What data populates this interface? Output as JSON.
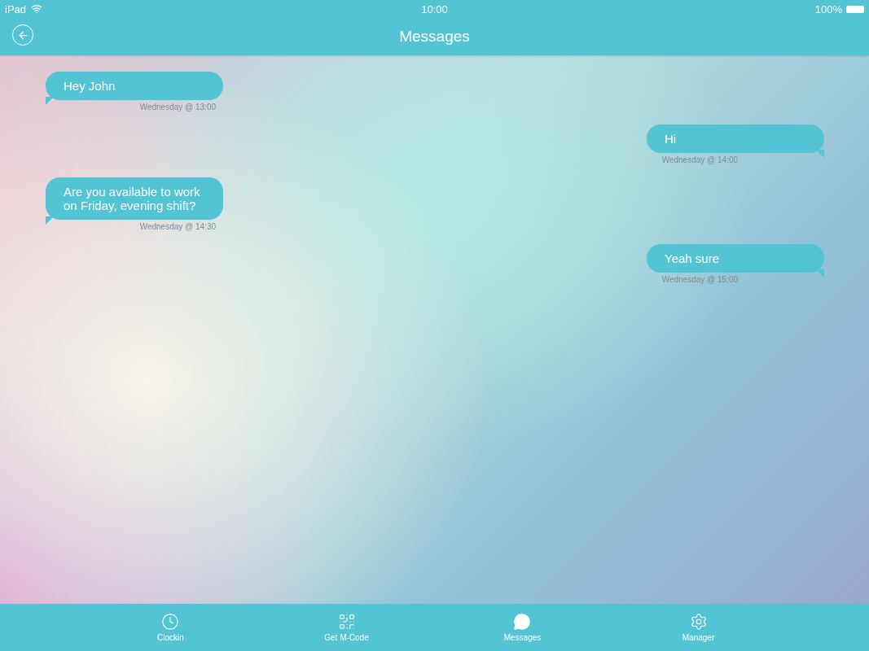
{
  "status_bar": {
    "device": "iPad",
    "time": "10:00",
    "battery": "100%"
  },
  "nav_bar": {
    "title": "Messages"
  },
  "messages": [
    {
      "kind": "incoming",
      "text": "Hey John",
      "time": "Wednesday @ 13:00"
    },
    {
      "kind": "outgoing",
      "text": "Hi",
      "time": "Wednesday @ 14:00"
    },
    {
      "kind": "incoming",
      "text": "Are you available to work on Friday, evening shift?",
      "time": "Wednesday @ 14:30"
    },
    {
      "kind": "outgoing",
      "text": "Yeah sure",
      "time": "Wednesday @ 15:00"
    }
  ],
  "tab_bar": [
    {
      "label": "Clockin"
    },
    {
      "label": "Get M-Code"
    },
    {
      "label": "Messages"
    },
    {
      "label": "Manager"
    }
  ]
}
